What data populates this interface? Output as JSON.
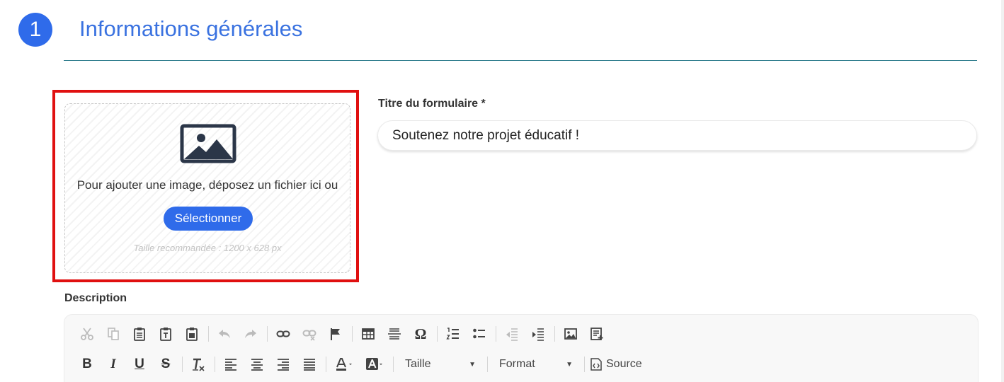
{
  "section": {
    "step_number": "1",
    "title": "Informations générales"
  },
  "image_upload": {
    "prompt": "Pour ajouter une image, déposez un fichier ici ou",
    "select_label": "Sélectionner",
    "hint": "Taille recommandée : 1200 x 628 px",
    "icon": "image-icon"
  },
  "form_title": {
    "label": "Titre du formulaire *",
    "value": "Soutenez notre projet éducatif !"
  },
  "description": {
    "label": "Description",
    "toolbar": {
      "size_label": "Taille",
      "format_label": "Format",
      "source_label": "Source",
      "bold_glyph": "B",
      "italic_glyph": "I",
      "underline_glyph": "U",
      "strike_glyph": "S",
      "special_char_glyph": "Ω"
    }
  },
  "colors": {
    "accent": "#2f6bea",
    "title": "#3a72e0",
    "highlight": "#e01010"
  }
}
